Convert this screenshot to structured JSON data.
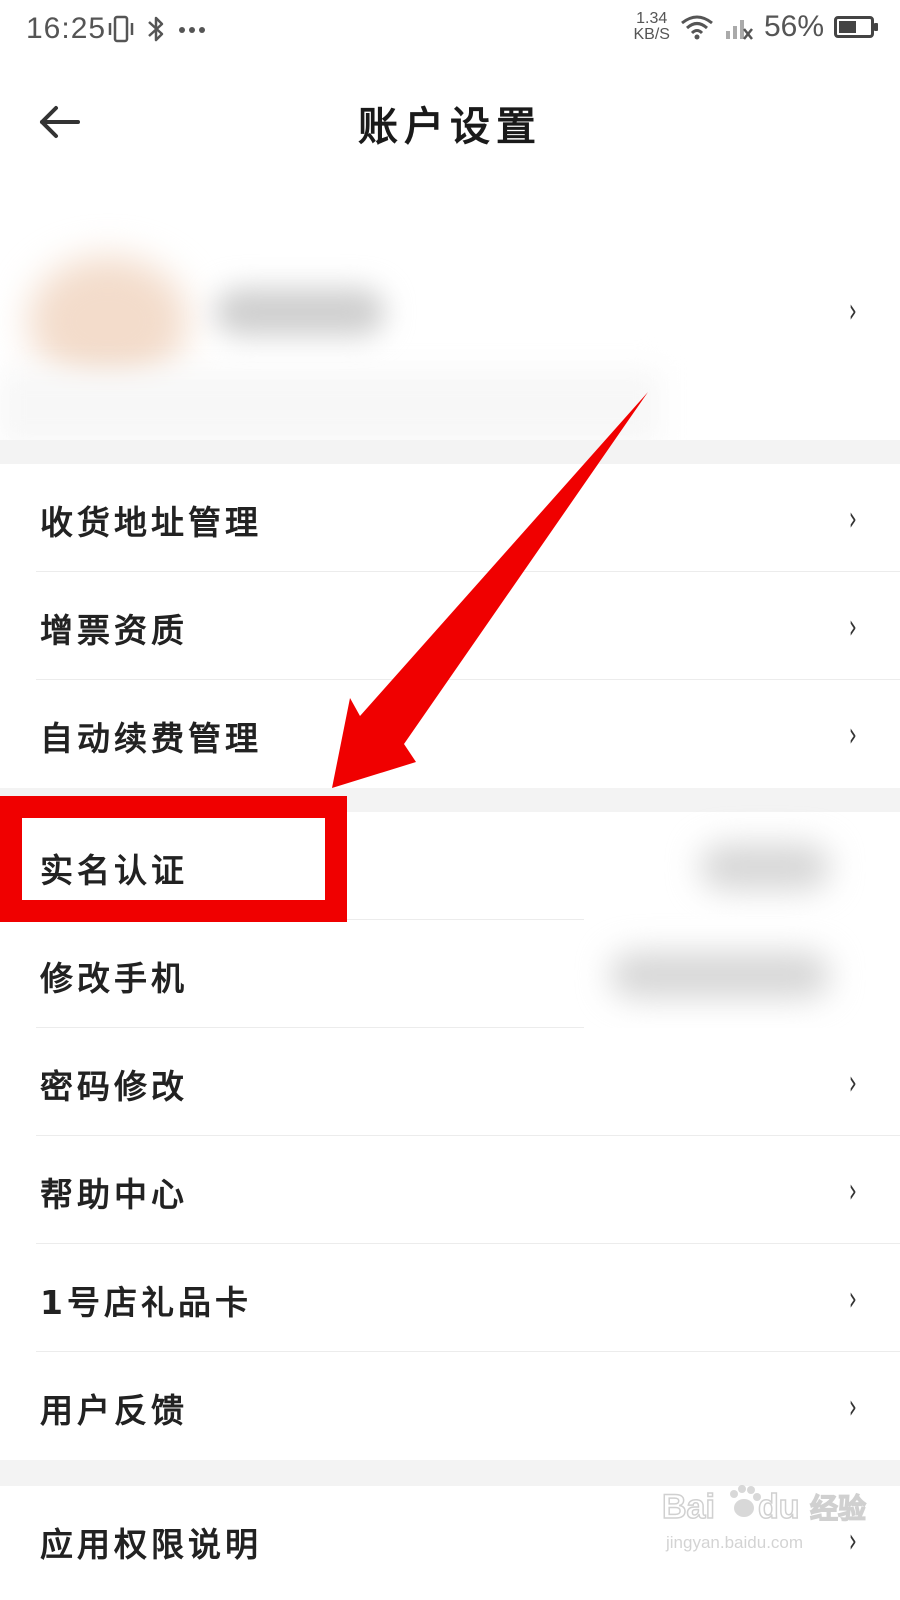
{
  "status_bar": {
    "time": "16:25",
    "net_speed_value": "1.34",
    "net_speed_unit": "KB/S",
    "battery_text": "56%",
    "battery_level": 0.56,
    "icons": [
      "vibrate-icon",
      "bluetooth-icon",
      "more-dots-icon",
      "wifi-icon",
      "signal-no-sim-icon",
      "battery-icon"
    ]
  },
  "header": {
    "title": "账户设置",
    "back_icon": "arrow-left-icon"
  },
  "profile": {
    "chevron": "›"
  },
  "menu": {
    "group1": [
      {
        "label": "收货地址管理",
        "chevron": "›"
      },
      {
        "label": "增票资质",
        "chevron": "›"
      },
      {
        "label": "自动续费管理",
        "chevron": "›"
      }
    ],
    "group2": [
      {
        "label": "实名认证"
      },
      {
        "label": "修改手机"
      },
      {
        "label": "密码修改",
        "chevron": "›"
      },
      {
        "label": "帮助中心",
        "chevron": "›"
      },
      {
        "label": "1号店礼品卡",
        "chevron": "›"
      },
      {
        "label": "用户反馈",
        "chevron": "›"
      }
    ],
    "group3": [
      {
        "label": "应用权限说明",
        "chevron": "›"
      }
    ]
  },
  "annotation": {
    "color": "#f00000",
    "highlight_target": "实名认证"
  },
  "watermark": {
    "brand": "Bai",
    "brand_suffix": "经验",
    "url": "jingyan.baidu.com"
  }
}
